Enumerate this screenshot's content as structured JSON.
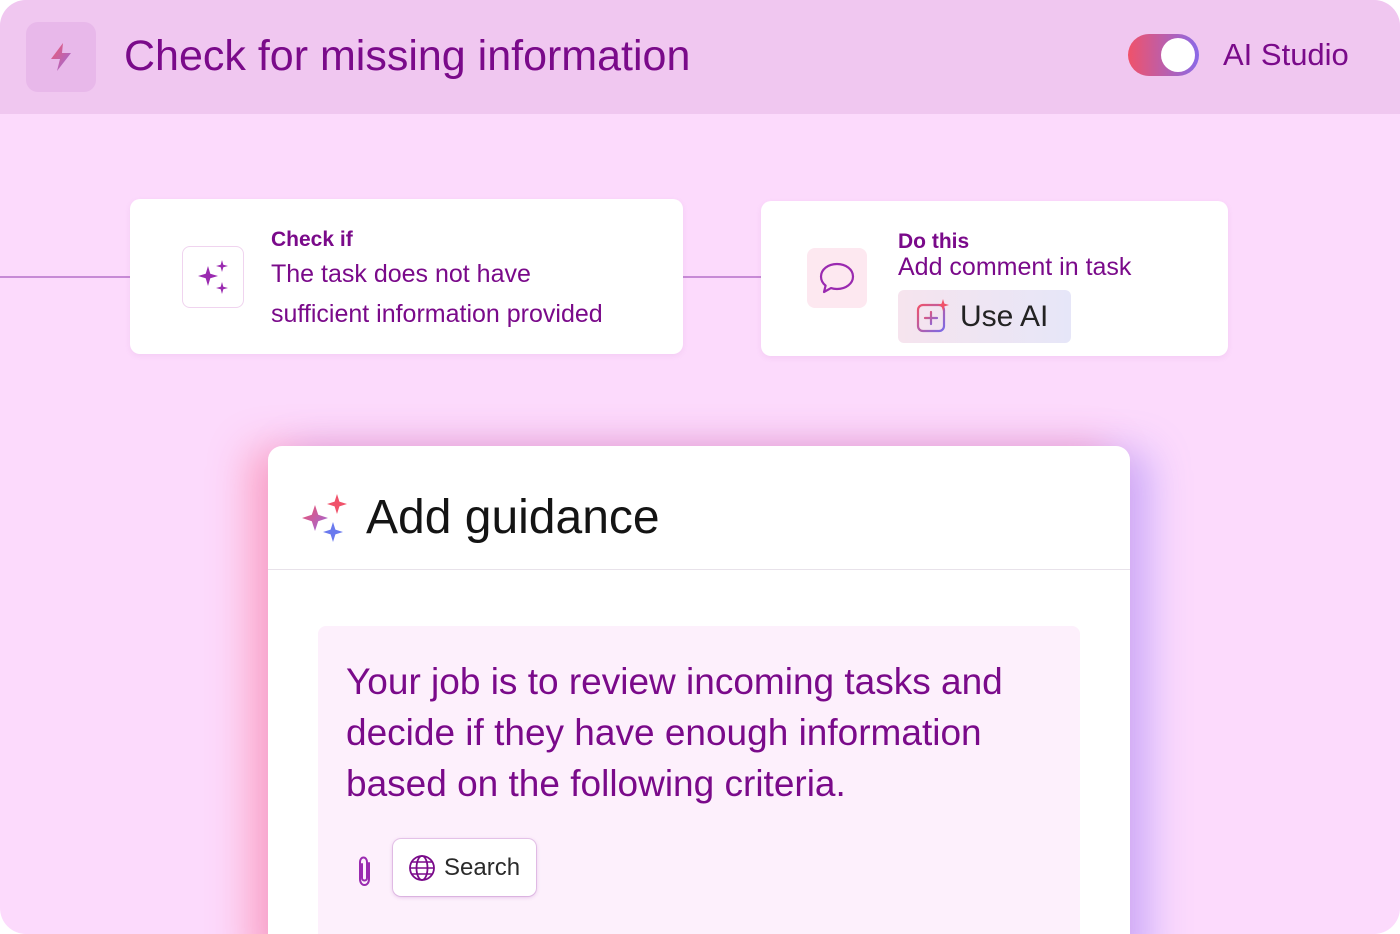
{
  "header": {
    "icon": "lightning-bolt-icon",
    "title": "Check for missing information",
    "toggle_label": "AI Studio",
    "toggle_on": true
  },
  "flow": {
    "condition": {
      "icon": "sparkles-icon",
      "heading": "Check if",
      "line1": "The task does not have",
      "line2": "sufficient information provided"
    },
    "action": {
      "icon": "speech-bubble-icon",
      "heading": "Do this",
      "text": "Add comment in task",
      "ai_button_icon": "ai-plus-icon",
      "ai_button_label": "Use AI"
    }
  },
  "guidance": {
    "icon": "sparkles-icon",
    "title": "Add guidance",
    "prompt": "Your job is to review incoming tasks and decide if they have enough information based on the following criteria.",
    "attach_icon": "paperclip-icon",
    "search_icon": "globe-icon",
    "search_label": "Search"
  },
  "colors": {
    "background": "#fcdafc",
    "header_bg": "#f0c7f0",
    "text_accent": "#7a0a8a",
    "toggle_start": "#f0526a",
    "toggle_end": "#8a6ae8"
  }
}
